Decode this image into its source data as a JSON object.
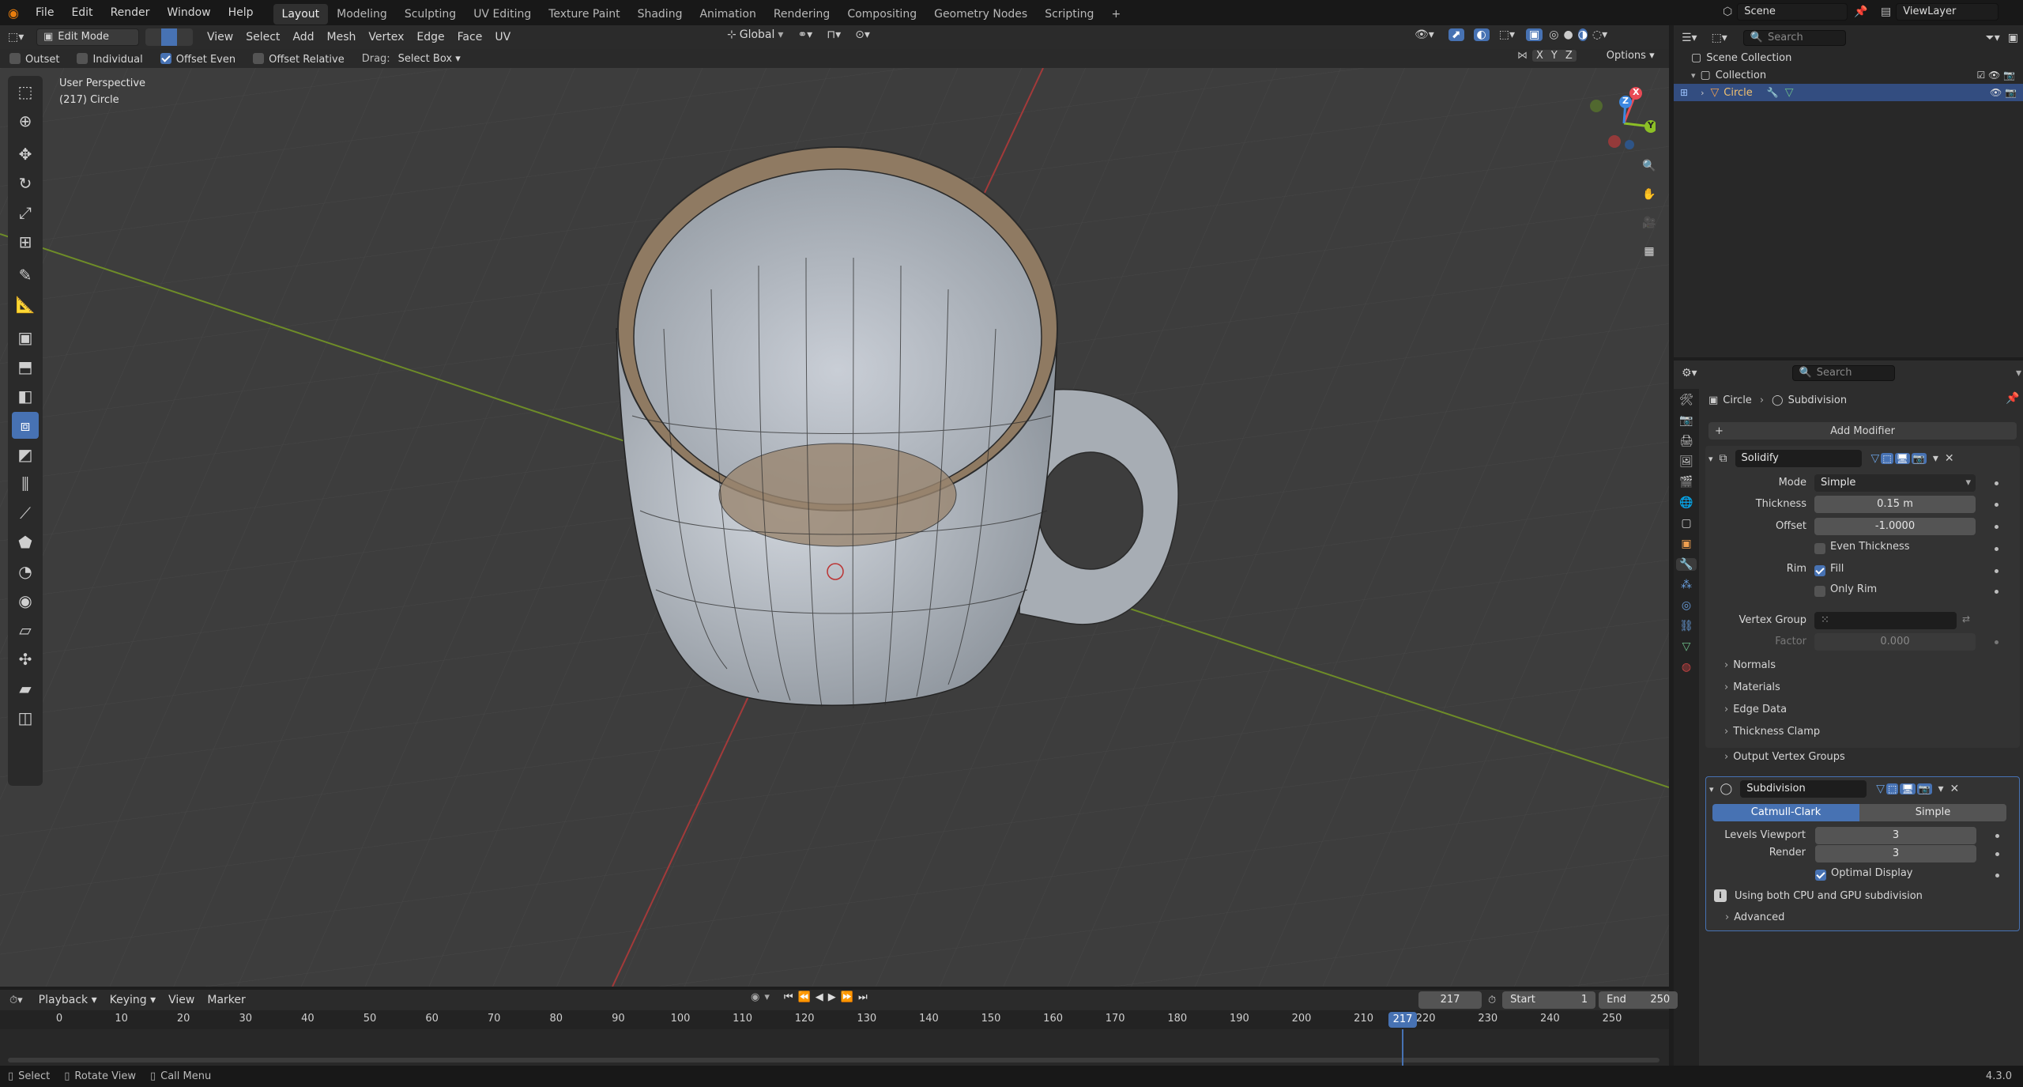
{
  "topbar": {
    "menus": [
      "File",
      "Edit",
      "Render",
      "Window",
      "Help"
    ],
    "workspaces": [
      "Layout",
      "Modeling",
      "Sculpting",
      "UV Editing",
      "Texture Paint",
      "Shading",
      "Animation",
      "Rendering",
      "Compositing",
      "Geometry Nodes",
      "Scripting"
    ],
    "active_workspace": "Layout",
    "add_tab": "+",
    "scene": "Scene",
    "view_layer": "ViewLayer"
  },
  "viewport_header": {
    "mode": "Edit Mode",
    "menus": [
      "View",
      "Select",
      "Add",
      "Mesh",
      "Vertex",
      "Edge",
      "Face",
      "UV"
    ],
    "transform_orientation": "Global",
    "options": "Options",
    "axes": [
      "X",
      "Y",
      "Z"
    ]
  },
  "tool_settings": {
    "outset": "Outset",
    "individual": "Individual",
    "offset_even": "Offset Even",
    "offset_relative": "Offset Relative",
    "drag_label": "Drag:",
    "drag_value": "Select Box"
  },
  "viewport": {
    "perspective": "User Perspective",
    "object_info": "(217) Circle",
    "gizmo_axes": [
      "X",
      "Y",
      "Z"
    ],
    "colors": {
      "x": "#e94a55",
      "y": "#8cbf26",
      "z": "#3d88e0",
      "bg": "#3d3d3d",
      "grid": "#4a4a4a"
    }
  },
  "outliner": {
    "search_placeholder": "Search",
    "scene_collection": "Scene Collection",
    "collection": "Collection",
    "object": "Circle"
  },
  "properties": {
    "search_placeholder": "Search",
    "breadcrumb_object": "Circle",
    "breadcrumb_modifier": "Subdivision",
    "add_modifier": "Add Modifier",
    "solidify": {
      "name": "Solidify",
      "mode_label": "Mode",
      "mode_value": "Simple",
      "thickness_label": "Thickness",
      "thickness_value": "0.15 m",
      "offset_label": "Offset",
      "offset_value": "-1.0000",
      "even_thickness": "Even Thickness",
      "rim_label": "Rim",
      "fill": "Fill",
      "only_rim": "Only Rim",
      "vertex_group_label": "Vertex Group",
      "factor_label": "Factor",
      "factor_value": "0.000",
      "sections": [
        "Normals",
        "Materials",
        "Edge Data",
        "Thickness Clamp",
        "Output Vertex Groups"
      ]
    },
    "subdivision": {
      "name": "Subdivision",
      "catmull": "Catmull-Clark",
      "simple": "Simple",
      "levels_viewport_label": "Levels Viewport",
      "levels_viewport_value": "3",
      "render_label": "Render",
      "render_value": "3",
      "optimal_display": "Optimal Display",
      "info": "Using both CPU and GPU subdivision",
      "advanced": "Advanced"
    }
  },
  "timeline": {
    "menus": [
      "Playback",
      "Keying",
      "View",
      "Marker"
    ],
    "current_frame": "217",
    "start_label": "Start",
    "start_value": "1",
    "end_label": "End",
    "end_value": "250",
    "ticks": [
      "0",
      "10",
      "20",
      "30",
      "40",
      "50",
      "60",
      "70",
      "80",
      "90",
      "100",
      "110",
      "120",
      "130",
      "140",
      "150",
      "160",
      "170",
      "180",
      "190",
      "200",
      "210",
      "220",
      "230",
      "240",
      "250"
    ],
    "playhead": "217"
  },
  "statusbar": {
    "select": "Select",
    "rotate": "Rotate View",
    "call_menu": "Call Menu",
    "version": "4.3.0"
  }
}
